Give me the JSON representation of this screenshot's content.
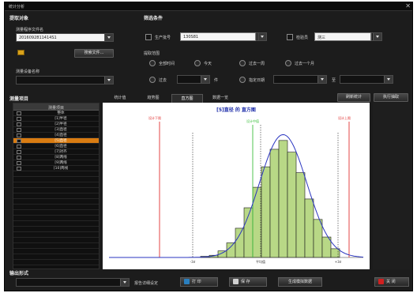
{
  "window": {
    "title": "统计分析",
    "close_glyph": "✕"
  },
  "source": {
    "section": "提取对象",
    "file_label": "测量程序文件名",
    "file_value": "2016092811414S1",
    "browse_button": "搜索文件...",
    "device_label": "测量设备名称",
    "device_value": ""
  },
  "filter": {
    "section": "筛选条件",
    "product_label": "生产批号",
    "product_value": "130S81",
    "inspector_label": "检验员",
    "inspector_value": "测三",
    "range_label": "提取范围",
    "radios": [
      "全部时间",
      "今天",
      "过去一周",
      "过去一个月"
    ],
    "past_label": "过去",
    "days_unit": "件",
    "custom_label": "指定日期",
    "to_label": "至"
  },
  "items": {
    "section": "测量项目",
    "header": "测量项目",
    "rows": [
      {
        "label": "整体",
        "selected": false
      },
      {
        "label": "[1]半径",
        "selected": false
      },
      {
        "label": "[2]半径",
        "selected": false
      },
      {
        "label": "[3]直径",
        "selected": false
      },
      {
        "label": "[4]直径",
        "selected": false
      },
      {
        "label": "[5]直径",
        "selected": true
      },
      {
        "label": "[6]直径",
        "selected": false
      },
      {
        "label": "[7]对齐",
        "selected": false
      },
      {
        "label": "[8]两线",
        "selected": false
      },
      {
        "label": "[9]两线",
        "selected": false
      },
      {
        "label": "[10]两线",
        "selected": false
      }
    ]
  },
  "tabs": [
    "统计值",
    "趋势图",
    "直方图",
    "数据一览"
  ],
  "active_tab": 2,
  "actions": {
    "reset_stats": "刷新统计",
    "execute_extract": "执行抽取"
  },
  "chart_data": {
    "type": "bar",
    "title": "[5]直径 的 直方图",
    "values": [
      0.8,
      1.5,
      4.5,
      10,
      20,
      34,
      48,
      62,
      74,
      80,
      72,
      58,
      40,
      26,
      14,
      6
    ],
    "curve": "normal",
    "ref_labels": {
      "lsl": "设计下限",
      "target": "设计中值",
      "usl": "设计上限"
    },
    "tick_labels": [
      "-3σ",
      "平均值",
      "+3σ"
    ],
    "colors": {
      "bar_fill": "#b8d886",
      "bar_stroke": "#1a1a1a",
      "curve": "#2a35c0",
      "limit": "#e03030",
      "target": "#40c040",
      "title": "#1a2aa8"
    }
  },
  "bottom": {
    "section": "输出形式",
    "output_value": "",
    "report_settings": "报告详细设定",
    "print_button": "打 印",
    "save_button": "保 存",
    "generate_button": "生成模拟数据",
    "close_button": "关 闭"
  }
}
